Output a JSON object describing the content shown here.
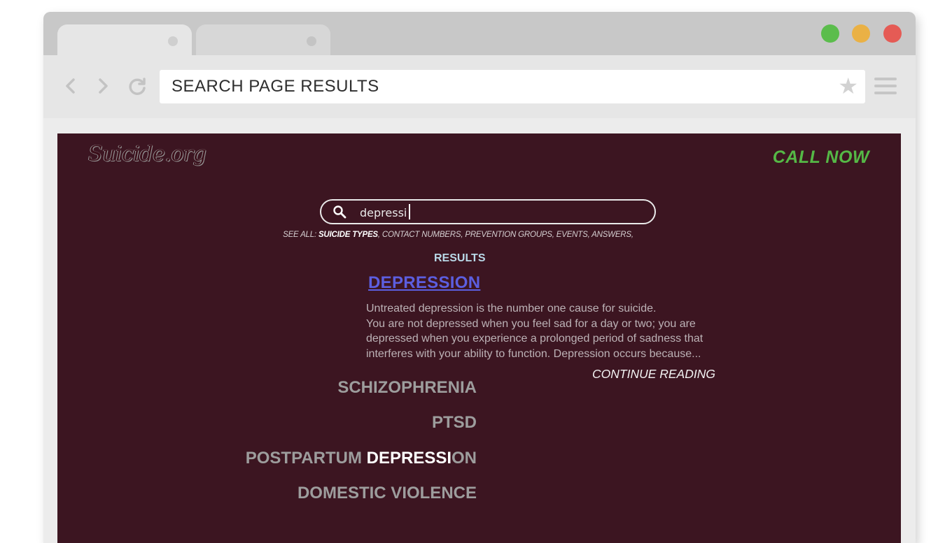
{
  "browser": {
    "address_text": "SEARCH PAGE RESULTS",
    "window_colors": {
      "green": "#5bbd4c",
      "yellow": "#eab145",
      "red": "#e55b55"
    }
  },
  "site": {
    "logo": "Suicide.org",
    "call_now": "CALL NOW",
    "background_color": "#3c1521",
    "accent_color": "#55b846"
  },
  "search": {
    "value": "depressi"
  },
  "see_all": {
    "prefix": "SEE ALL: ",
    "items": [
      {
        "label": "SUICIDE TYPES",
        "emphasis": true
      },
      {
        "label": "CONTACT NUMBERS",
        "emphasis": false
      },
      {
        "label": "PREVENTION GROUPS",
        "emphasis": false
      },
      {
        "label": "EVENTS",
        "emphasis": false
      },
      {
        "label": "ANSWERS",
        "emphasis": false
      }
    ]
  },
  "results": {
    "label": "RESULTS",
    "top": {
      "title": "DEPRESSION",
      "excerpt_lines": [
        "Untreated depression is the number one cause for suicide.",
        "You are not depressed when you feel sad for a day or two; you are",
        "depressed when you experience a prolonged period of sadness that",
        "interferes with your ability to function. Depression occurs because..."
      ],
      "continue_label": "CONTINUE READING"
    },
    "others": [
      {
        "parts": [
          {
            "text": "SCHIZOPHRENIA",
            "hl": false
          }
        ]
      },
      {
        "parts": [
          {
            "text": "PTSD",
            "hl": false
          }
        ]
      },
      {
        "parts": [
          {
            "text": "POSTPARTUM ",
            "hl": false
          },
          {
            "text": "DEPRESSI",
            "hl": true
          },
          {
            "text": "ON",
            "hl": false
          }
        ]
      },
      {
        "parts": [
          {
            "text": "DOMESTIC VIOLENCE",
            "hl": false
          }
        ]
      }
    ]
  }
}
